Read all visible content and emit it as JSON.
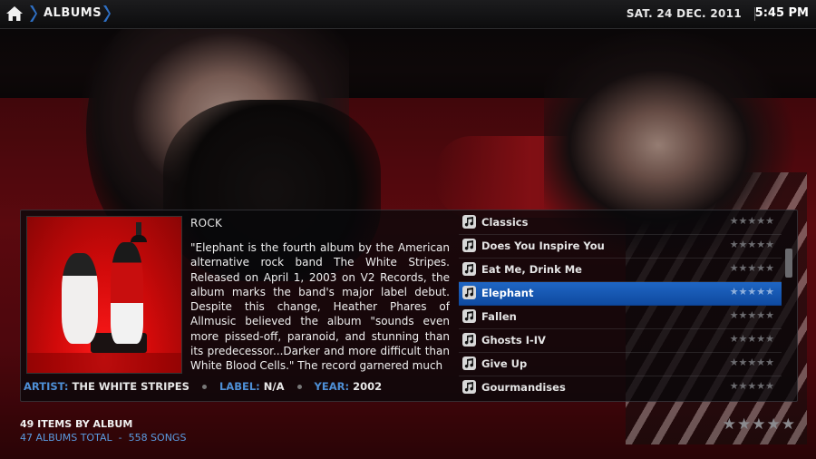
{
  "header": {
    "breadcrumb": "ALBUMS",
    "date": "SAT. 24 DEC. 2011",
    "time": "5:45 PM"
  },
  "details": {
    "genre": "ROCK",
    "plot": "\"Elephant is the fourth album by the American alternative rock band The White Stripes. Released on April 1, 2003 on V2 Records, the album marks the band's major label debut. Despite this change, Heather Phares of Allmusic believed the album \"sounds even more pissed-off, paranoid, and stunning than its predecessor...Darker and more difficult than White Blood Cells.\" The record garnered much",
    "artist_label": "ARTIST:",
    "artist_value": "THE WHITE STRIPES",
    "label_label": "LABEL:",
    "label_value": "N/A",
    "year_label": "YEAR:",
    "year_value": "2002"
  },
  "albums": [
    {
      "title": "Classics",
      "rating": "★★★★★"
    },
    {
      "title": "Does You Inspire You",
      "rating": "★★★★★"
    },
    {
      "title": "Eat Me, Drink Me",
      "rating": "★★★★★"
    },
    {
      "title": "Elephant",
      "rating": "★★★★★",
      "selected": true
    },
    {
      "title": "Fallen",
      "rating": "★★★★★"
    },
    {
      "title": "Ghosts I-IV",
      "rating": "★★★★★"
    },
    {
      "title": "Give Up",
      "rating": "★★★★★"
    },
    {
      "title": "Gourmandises",
      "rating": "★★★★★"
    }
  ],
  "footer": {
    "items": "49 ITEMS BY ALBUM",
    "totals": "47 ALBUMS TOTAL  -  558 SONGS",
    "rating": "★★★★★"
  },
  "colors": {
    "accent": "#4e8fd6",
    "selection": "#1556b0",
    "background_red": "#7e0d14"
  },
  "icons": {
    "home": "home-icon",
    "breadcrumb_separator": "chevron-right-icon",
    "album_item": "music-note-icon",
    "rating": "star-icon"
  }
}
